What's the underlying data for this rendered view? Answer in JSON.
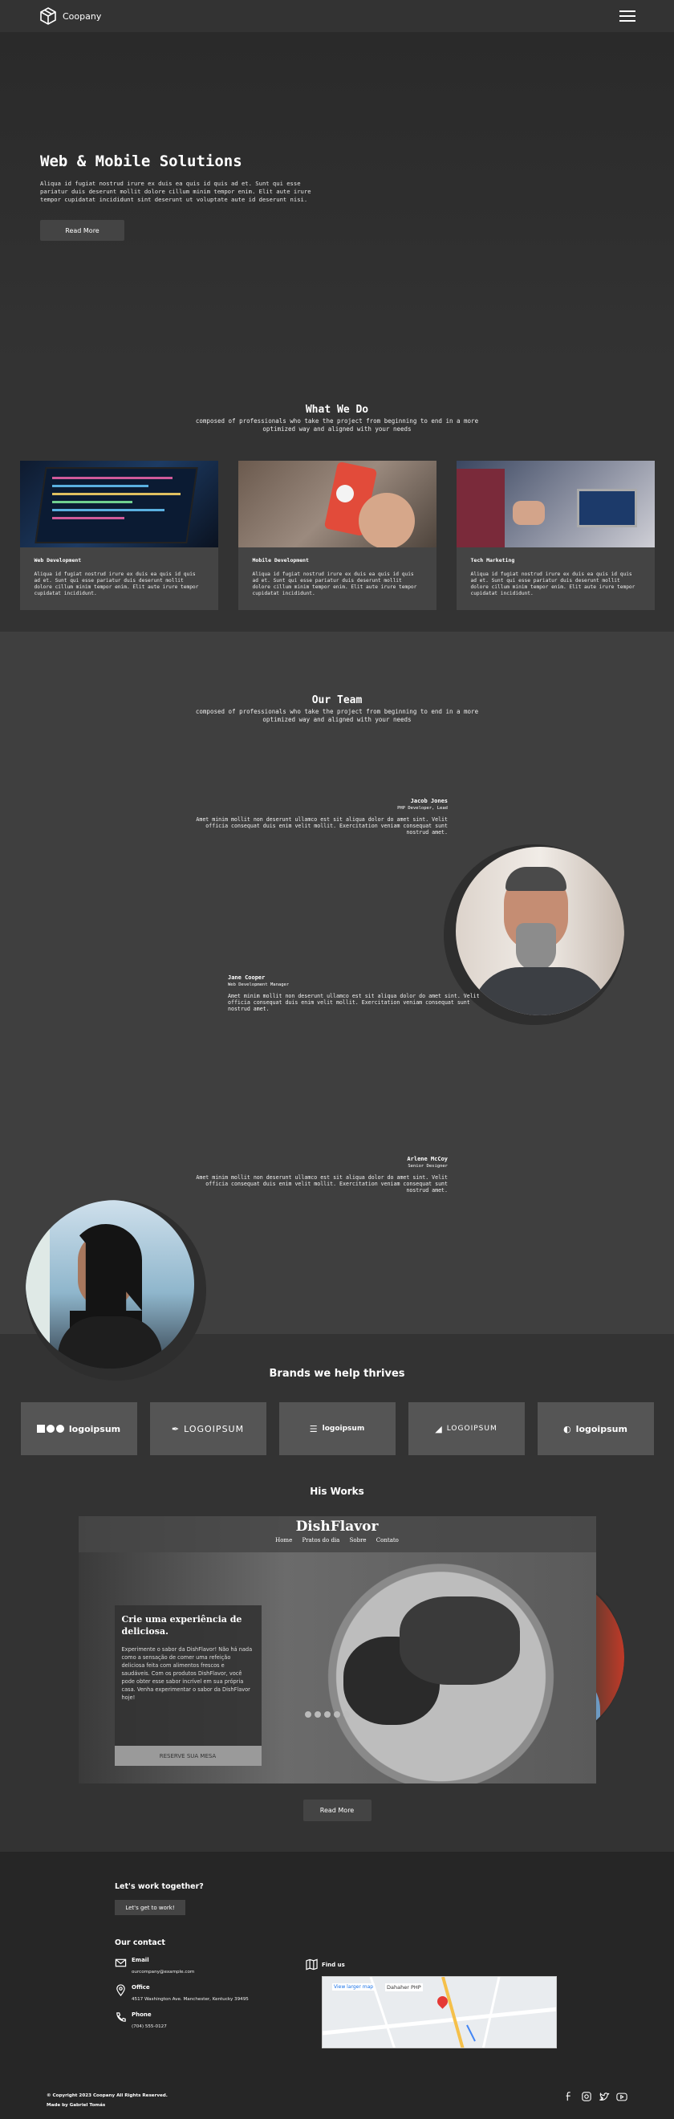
{
  "nav": {
    "brand": "Coopany",
    "menu_icon": "hamburger-icon"
  },
  "hero": {
    "title": "Web & Mobile Solutions",
    "text": "Aliqua id fugiat nostrud irure ex duis ea quis id quis ad et. Sunt qui esse pariatur duis deserunt mollit dolore cillum minim tempor enim. Elit aute irure tempor cupidatat incididunt sint deserunt ut voluptate aute id deserunt nisi.",
    "button": "Read More"
  },
  "what_we_do": {
    "title": "What We Do",
    "subtitle": "composed of professionals who take the project from beginning to end in a more optimized way and aligned with your needs",
    "cards": [
      {
        "title": "Web Development",
        "text": "Aliqua id fugiat nostrud irure ex duis ea quis id quis ad et. Sunt qui esse pariatur duis deserunt mollit dolore cillum minim tempor enim. Elit aute irure tempor cupidatat incididunt."
      },
      {
        "title": "Mobile Development",
        "text": "Aliqua id fugiat nostrud irure ex duis ea quis id quis ad et. Sunt qui esse pariatur duis deserunt mollit dolore cillum minim tempor enim. Elit aute irure tempor cupidatat incididunt."
      },
      {
        "title": "Tech Marketing",
        "text": "Aliqua id fugiat nostrud irure ex duis ea quis id quis ad et. Sunt qui esse pariatur duis deserunt mollit dolore cillum minim tempor enim. Elit aute irure tempor cupidatat incididunt."
      }
    ]
  },
  "team": {
    "title": "Our Team",
    "subtitle": "composed of professionals who take the project from beginning to end in a more optimized way and aligned with your needs",
    "members": [
      {
        "name": "Jacob Jones",
        "role": "PHP Developer, Lead",
        "text": "Amet minim mollit non deserunt ullamco est sit aliqua dolor do amet sint. Velit officia consequat duis enim velit mollit. Exercitation veniam consequat sunt nostrud amet."
      },
      {
        "name": "Jane Cooper",
        "role": "Web Development Manager",
        "text": "Amet minim mollit non deserunt ullamco est sit aliqua dolor do amet sint. Velit officia consequat duis enim velit mollit. Exercitation veniam consequat sunt nostrud amet."
      },
      {
        "name": "Arlene McCoy",
        "role": "Senior Designer",
        "text": "Amet minim mollit non deserunt ullamco est sit aliqua dolor do amet sint. Velit officia consequat duis enim velit mollit. Exercitation veniam consequat sunt nostrud amet."
      }
    ]
  },
  "brands": {
    "title": "Brands we help thrives",
    "logos": [
      "logoipsum",
      "LOGOIPSUM",
      "logoipsum",
      "LOGOIPSUM",
      "logoipsum"
    ]
  },
  "works": {
    "title": "His Works",
    "showcase": {
      "logo": "DishFlavor",
      "menu": [
        "Home",
        "Pratos do dia",
        "Sobre",
        "Contato"
      ],
      "headline": "Crie uma experiência de deliciosa.",
      "text": "Experimente o sabor da DishFlavor! Não há nada como a sensação de comer uma refeição deliciosa feita com alimentos frescos e saudáveis. Com os produtos DishFlavor, você pode obter esse sabor incrível em sua própria casa. Venha experimentar o sabor da DishFlavor hoje!",
      "button": "RESERVE SUA MESA"
    },
    "button": "Read More"
  },
  "footer": {
    "cta_title": "Let's work together?",
    "cta_button": "Let's get to work!",
    "contact_title": "Our contact",
    "email_label": "Email",
    "email": "ourcompany@example.com",
    "office_label": "Office",
    "office": "4517 Washington Ave. Manchester, Kentucky 39495",
    "phone_label": "Phone",
    "phone": "(704) 555-0127",
    "find_label": "Find us",
    "map_link": "View larger map",
    "map_place": "Dahaher PHP",
    "copyright": "© Copyright 2023 Coopany All Rights Reserved.",
    "made_by": "Made by Gabriel Tomás"
  }
}
